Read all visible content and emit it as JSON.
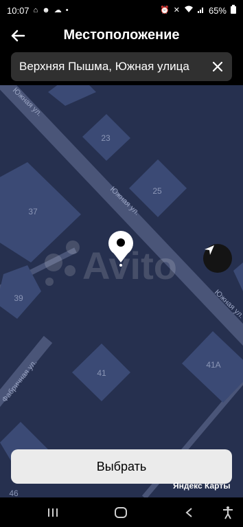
{
  "status_bar": {
    "time": "10:07",
    "battery": "65%",
    "left_icons": [
      "home-icon",
      "people-icon",
      "cloud-icon",
      "dot-icon"
    ],
    "right_icons": [
      "alarm-icon",
      "mute-icon",
      "wifi-icon",
      "signal-icon",
      "battery-icon"
    ]
  },
  "header": {
    "title": "Местоположение",
    "back_icon": "arrow-left-icon"
  },
  "search": {
    "value": "Верхняя Пышма, Южная улица",
    "clear_icon": "close-icon"
  },
  "map": {
    "streets": [
      "Южная ул.",
      "Южная ул.",
      "Южная ул.",
      "Фабричная ул."
    ],
    "buildings": [
      "23",
      "25",
      "37",
      "39",
      "41",
      "41А",
      "46"
    ],
    "watermark": "Avito",
    "colors": {
      "background": "#26304f",
      "building": "#3b4a75",
      "road": "#4a5578"
    },
    "attribution": "Яндекс Карты"
  },
  "actions": {
    "locate_icon": "navigation-arrow-icon",
    "select_label": "Выбрать"
  },
  "nav_bar": {
    "icons": [
      "recent-apps-icon",
      "home-button-icon",
      "back-icon",
      "accessibility-icon"
    ]
  }
}
